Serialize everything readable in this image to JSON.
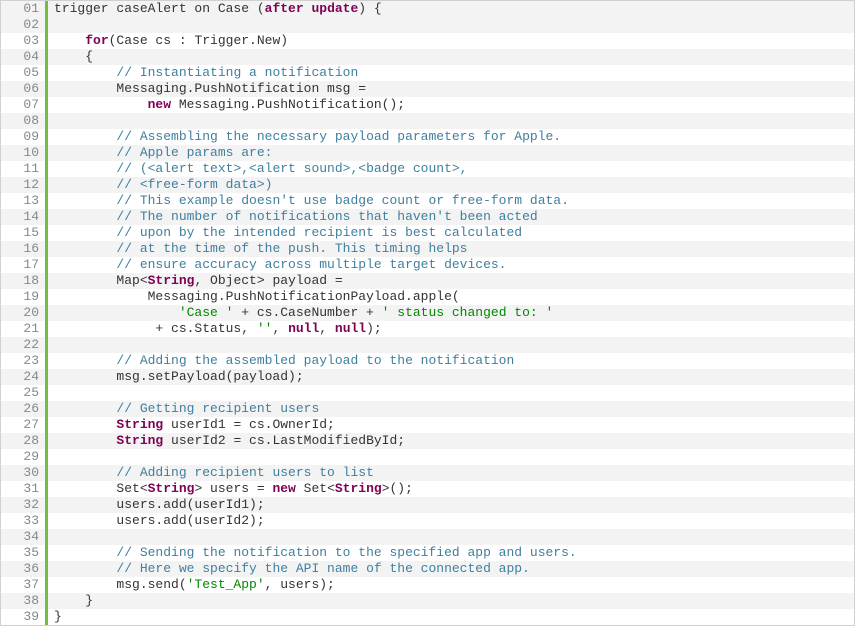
{
  "lines": [
    {
      "n": "01",
      "tokens": [
        {
          "t": "trigger caseAlert on Case (",
          "c": "pl"
        },
        {
          "t": "after",
          "c": "kw"
        },
        {
          "t": " ",
          "c": "pl"
        },
        {
          "t": "update",
          "c": "kw"
        },
        {
          "t": ") {",
          "c": "pl"
        }
      ]
    },
    {
      "n": "02",
      "tokens": []
    },
    {
      "n": "03",
      "tokens": [
        {
          "t": "    ",
          "c": "pl"
        },
        {
          "t": "for",
          "c": "kw"
        },
        {
          "t": "(Case cs : Trigger.New)",
          "c": "pl"
        }
      ]
    },
    {
      "n": "04",
      "tokens": [
        {
          "t": "    {",
          "c": "pl"
        }
      ]
    },
    {
      "n": "05",
      "tokens": [
        {
          "t": "        ",
          "c": "pl"
        },
        {
          "t": "// Instantiating a notification",
          "c": "cm"
        }
      ]
    },
    {
      "n": "06",
      "tokens": [
        {
          "t": "        Messaging.PushNotification msg =",
          "c": "pl"
        }
      ]
    },
    {
      "n": "07",
      "tokens": [
        {
          "t": "            ",
          "c": "pl"
        },
        {
          "t": "new",
          "c": "kw"
        },
        {
          "t": " Messaging.PushNotification();",
          "c": "pl"
        }
      ]
    },
    {
      "n": "08",
      "tokens": []
    },
    {
      "n": "09",
      "tokens": [
        {
          "t": "        ",
          "c": "pl"
        },
        {
          "t": "// Assembling the necessary payload parameters for Apple.",
          "c": "cm"
        }
      ]
    },
    {
      "n": "10",
      "tokens": [
        {
          "t": "        ",
          "c": "pl"
        },
        {
          "t": "// Apple params are:",
          "c": "cm"
        }
      ]
    },
    {
      "n": "11",
      "tokens": [
        {
          "t": "        ",
          "c": "pl"
        },
        {
          "t": "// (<alert text>,<alert sound>,<badge count>,",
          "c": "cm"
        }
      ]
    },
    {
      "n": "12",
      "tokens": [
        {
          "t": "        ",
          "c": "pl"
        },
        {
          "t": "// <free-form data>)",
          "c": "cm"
        }
      ]
    },
    {
      "n": "13",
      "tokens": [
        {
          "t": "        ",
          "c": "pl"
        },
        {
          "t": "// This example doesn't use badge count or free-form data.",
          "c": "cm"
        }
      ]
    },
    {
      "n": "14",
      "tokens": [
        {
          "t": "        ",
          "c": "pl"
        },
        {
          "t": "// The number of notifications that haven't been acted",
          "c": "cm"
        }
      ]
    },
    {
      "n": "15",
      "tokens": [
        {
          "t": "        ",
          "c": "pl"
        },
        {
          "t": "// upon by the intended recipient is best calculated",
          "c": "cm"
        }
      ]
    },
    {
      "n": "16",
      "tokens": [
        {
          "t": "        ",
          "c": "pl"
        },
        {
          "t": "// at the time of the push. This timing helps",
          "c": "cm"
        }
      ]
    },
    {
      "n": "17",
      "tokens": [
        {
          "t": "        ",
          "c": "pl"
        },
        {
          "t": "// ensure accuracy across multiple target devices.",
          "c": "cm"
        }
      ]
    },
    {
      "n": "18",
      "tokens": [
        {
          "t": "        Map<",
          "c": "pl"
        },
        {
          "t": "String",
          "c": "kw"
        },
        {
          "t": ", Object> payload =",
          "c": "pl"
        }
      ]
    },
    {
      "n": "19",
      "tokens": [
        {
          "t": "            Messaging.PushNotificationPayload.apple(",
          "c": "pl"
        }
      ]
    },
    {
      "n": "20",
      "tokens": [
        {
          "t": "                ",
          "c": "pl"
        },
        {
          "t": "'Case '",
          "c": "st"
        },
        {
          "t": " + cs.CaseNumber + ",
          "c": "pl"
        },
        {
          "t": "' status changed to: '",
          "c": "st"
        }
      ]
    },
    {
      "n": "21",
      "tokens": [
        {
          "t": "             + cs.Status, ",
          "c": "pl"
        },
        {
          "t": "''",
          "c": "st"
        },
        {
          "t": ", ",
          "c": "pl"
        },
        {
          "t": "null",
          "c": "kw"
        },
        {
          "t": ", ",
          "c": "pl"
        },
        {
          "t": "null",
          "c": "kw"
        },
        {
          "t": ");",
          "c": "pl"
        }
      ]
    },
    {
      "n": "22",
      "tokens": []
    },
    {
      "n": "23",
      "tokens": [
        {
          "t": "        ",
          "c": "pl"
        },
        {
          "t": "// Adding the assembled payload to the notification",
          "c": "cm"
        }
      ]
    },
    {
      "n": "24",
      "tokens": [
        {
          "t": "        msg.setPayload(payload);",
          "c": "pl"
        }
      ]
    },
    {
      "n": "25",
      "tokens": []
    },
    {
      "n": "26",
      "tokens": [
        {
          "t": "        ",
          "c": "pl"
        },
        {
          "t": "// Getting recipient users",
          "c": "cm"
        }
      ]
    },
    {
      "n": "27",
      "tokens": [
        {
          "t": "        ",
          "c": "pl"
        },
        {
          "t": "String",
          "c": "kw"
        },
        {
          "t": " userId1 = cs.OwnerId;",
          "c": "pl"
        }
      ]
    },
    {
      "n": "28",
      "tokens": [
        {
          "t": "        ",
          "c": "pl"
        },
        {
          "t": "String",
          "c": "kw"
        },
        {
          "t": " userId2 = cs.LastModifiedById;",
          "c": "pl"
        }
      ]
    },
    {
      "n": "29",
      "tokens": []
    },
    {
      "n": "30",
      "tokens": [
        {
          "t": "        ",
          "c": "pl"
        },
        {
          "t": "// Adding recipient users to list",
          "c": "cm"
        }
      ]
    },
    {
      "n": "31",
      "tokens": [
        {
          "t": "        Set<",
          "c": "pl"
        },
        {
          "t": "String",
          "c": "kw"
        },
        {
          "t": "> users = ",
          "c": "pl"
        },
        {
          "t": "new",
          "c": "kw"
        },
        {
          "t": " Set<",
          "c": "pl"
        },
        {
          "t": "String",
          "c": "kw"
        },
        {
          "t": ">();",
          "c": "pl"
        }
      ]
    },
    {
      "n": "32",
      "tokens": [
        {
          "t": "        users.add(userId1);",
          "c": "pl"
        }
      ]
    },
    {
      "n": "33",
      "tokens": [
        {
          "t": "        users.add(userId2);",
          "c": "pl"
        }
      ]
    },
    {
      "n": "34",
      "tokens": []
    },
    {
      "n": "35",
      "tokens": [
        {
          "t": "        ",
          "c": "pl"
        },
        {
          "t": "// Sending the notification to the specified app and users.",
          "c": "cm"
        }
      ]
    },
    {
      "n": "36",
      "tokens": [
        {
          "t": "        ",
          "c": "pl"
        },
        {
          "t": "// Here we specify the API name of the connected app.",
          "c": "cm"
        }
      ]
    },
    {
      "n": "37",
      "tokens": [
        {
          "t": "        msg.send(",
          "c": "pl"
        },
        {
          "t": "'Test_App'",
          "c": "st"
        },
        {
          "t": ", users);",
          "c": "pl"
        }
      ]
    },
    {
      "n": "38",
      "tokens": [
        {
          "t": "    }",
          "c": "pl"
        }
      ]
    },
    {
      "n": "39",
      "tokens": [
        {
          "t": "}",
          "c": "pl"
        }
      ]
    }
  ]
}
